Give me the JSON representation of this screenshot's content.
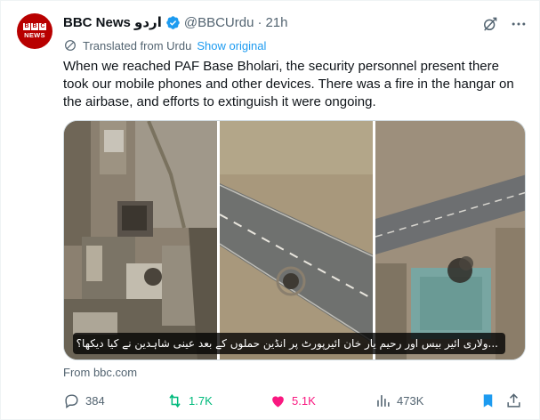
{
  "account": {
    "avatar_text_1": "B",
    "avatar_text_2": "B",
    "avatar_text_3": "C",
    "avatar_news": "NEWS",
    "display_name": "BBC News اردو",
    "handle": "@BBCUrdu",
    "separator": "·",
    "time": "21h"
  },
  "translation": {
    "label": "Translated from Urdu",
    "link": "Show original"
  },
  "tweet": {
    "text": "When we reached PAF Base Bholari, the security personnel present there took our mobile phones and other devices. There was a fire in the hangar on the airbase, and efforts to extinguish it were ongoing."
  },
  "card": {
    "caption": "...ولاری ائیر بیس اور رحیم یار خان ائیرپورٹ پر انڈین حملوں کے بعد عینی شاہدین نے کیا دیکھا؟",
    "source": "From bbc.com"
  },
  "actions": {
    "replies": "384",
    "retweets": "1.7K",
    "likes": "5.1K",
    "views": "473K"
  },
  "colors": {
    "accent": "#1d9bf0",
    "retweet": "#00ba7c",
    "like": "#f91880",
    "bookmark": "#1d9bf0",
    "brand": "#b80000"
  }
}
